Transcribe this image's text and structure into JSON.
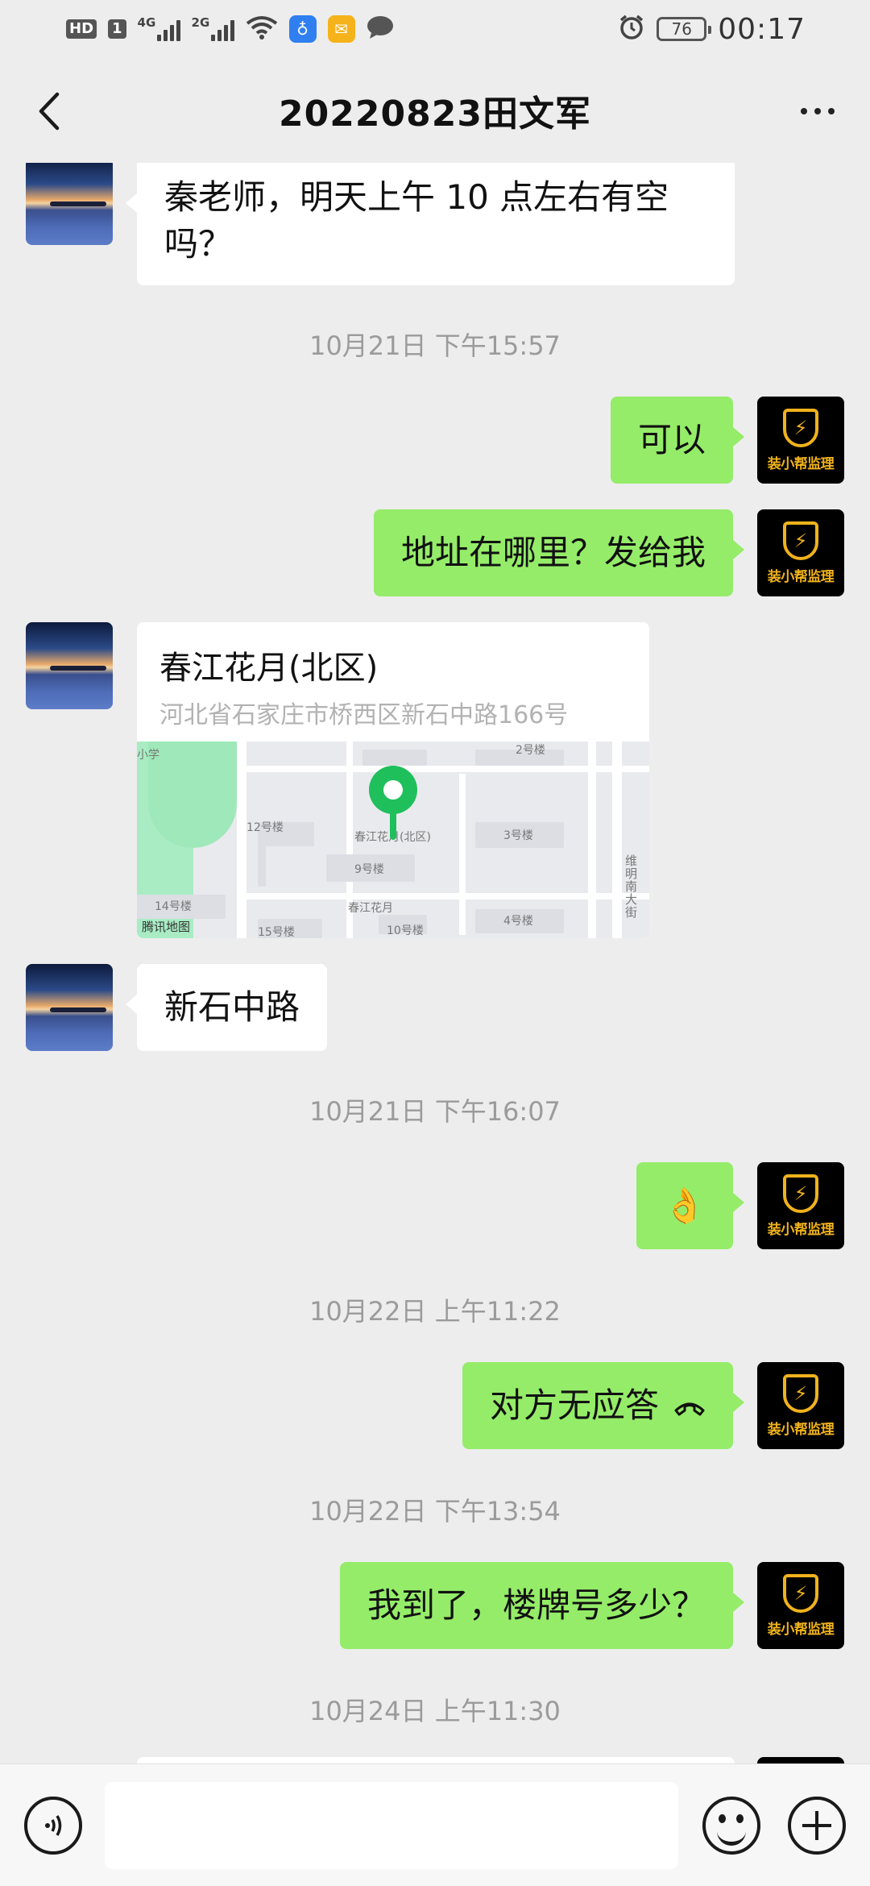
{
  "status_bar": {
    "hd": "HD",
    "sim": "1",
    "net1": "4G",
    "net2": "2G",
    "battery": "76",
    "time": "00:17"
  },
  "header": {
    "title": "20220823田文军"
  },
  "messages": [
    {
      "side": "left",
      "type": "text",
      "text": "秦老师，明天上午 10 点左右有空吗？",
      "line1": "秦老师，明天上午 10 点左右有空",
      "line2": "吗？"
    },
    {
      "type": "time",
      "text": "10月21日 下午15:57"
    },
    {
      "side": "right",
      "type": "text",
      "text": "可以"
    },
    {
      "side": "right",
      "type": "text",
      "text": "地址在哪里？发给我"
    },
    {
      "side": "left",
      "type": "location",
      "name": "春江花月(北区)",
      "address": "河北省石家庄市桥西区新石中路166号",
      "map_credit": "腾讯地图",
      "map_labels": [
        "春江花月(北区)",
        "春江花月",
        "12号楼",
        "9号楼",
        "14号楼",
        "15号楼",
        "10号楼",
        "3号楼",
        "4号楼",
        "2号楼",
        "维明南大街",
        "小学"
      ]
    },
    {
      "side": "left",
      "type": "text",
      "text": "新石中路"
    },
    {
      "type": "time",
      "text": "10月21日 下午16:07"
    },
    {
      "side": "right",
      "type": "emoji",
      "text": "👌"
    },
    {
      "type": "time",
      "text": "10月22日 上午11:22"
    },
    {
      "side": "right",
      "type": "call",
      "text": "对方无应答"
    },
    {
      "type": "time",
      "text": "10月22日 下午13:54"
    },
    {
      "side": "right",
      "type": "text",
      "text": "我到了，楼牌号多少？"
    },
    {
      "type": "time",
      "text": "10月24日 上午11:30"
    }
  ],
  "avatar_right_brand": "装小帮监理",
  "input_bar": {
    "placeholder": ""
  }
}
